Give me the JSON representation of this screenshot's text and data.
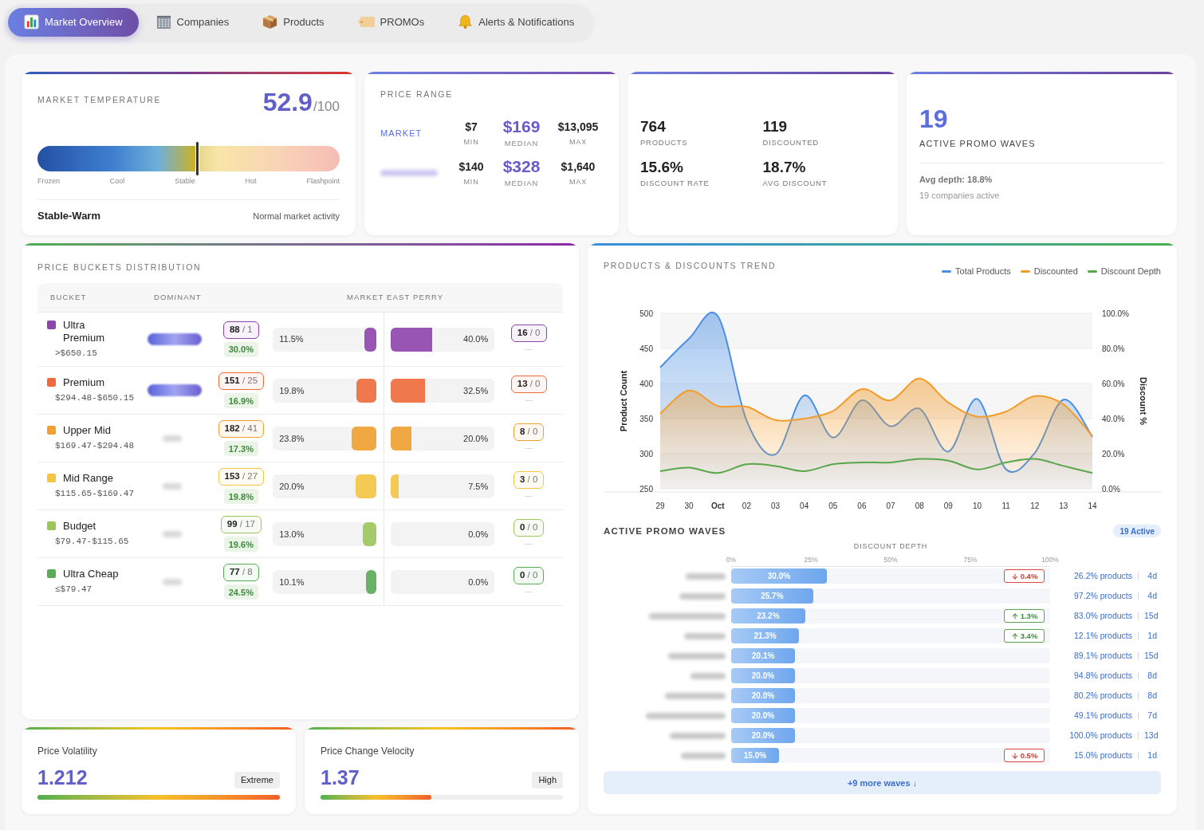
{
  "nav": {
    "tabs": [
      {
        "label": "Market Overview",
        "selected": true
      },
      {
        "label": "Companies",
        "selected": false
      },
      {
        "label": "Products",
        "selected": false
      },
      {
        "label": "PROMOs",
        "selected": false
      },
      {
        "label": "Alerts & Notifications",
        "selected": false
      }
    ]
  },
  "market_temperature": {
    "title": "MARKET TEMPERATURE",
    "value": "52.9",
    "scale": "/100",
    "level": 0.527,
    "scale_labels": [
      "Frozen",
      "Cool",
      "Stable",
      "Hot",
      "Flashpoint"
    ],
    "status": "Stable-Warm",
    "note": "Normal market activity"
  },
  "price_range": {
    "title": "PRICE RANGE",
    "rows": [
      {
        "label": "MARKET",
        "label_hidden": false,
        "min": "$7",
        "min_label": "MIN",
        "median": "$169",
        "median_label": "MEDIAN",
        "max": "$13,095",
        "max_label": "MAX"
      },
      {
        "label_hidden": true,
        "min": "$140",
        "min_label": "MIN",
        "median": "$328",
        "median_label": "MEDIAN",
        "max": "$1,640",
        "max_label": "MAX"
      }
    ]
  },
  "catalog_stats": {
    "items": [
      {
        "value": "764",
        "label": "PRODUCTS"
      },
      {
        "value": "119",
        "label": "DISCOUNTED"
      },
      {
        "value": "15.6%",
        "label": "DISCOUNT RATE"
      },
      {
        "value": "18.7%",
        "label": "AVG DISCOUNT"
      }
    ]
  },
  "promo_summary": {
    "value": "19",
    "label": "ACTIVE PROMO WAVES",
    "avg_depth": "Avg depth: 18.8%",
    "companies": "19 companies active"
  },
  "price_buckets": {
    "title": "PRICE BUCKETS DISTRIBUTION",
    "columns": [
      "BUCKET",
      "DOMINANT",
      "MARKET EAST PERRY"
    ],
    "rows": [
      {
        "name": "Ultra Premium",
        "range": ">$650.15",
        "color": "#8e44ad",
        "dominant": {
          "kind": "pill"
        },
        "market_count": "**88** / 1",
        "market_share": "30.0%",
        "market_bar": {
          "level": 0.115,
          "reading": "11.5%"
        },
        "east_perry_bar": {
          "level": 0.4,
          "reading": "40.0%"
        },
        "east_perry_count": "**16** / 0",
        "east_perry_note": "—"
      },
      {
        "name": "Premium",
        "range": "$294.48-$650.15",
        "color": "#ee6a3a",
        "dominant": {
          "kind": "pill"
        },
        "market_count": "**151** / 25",
        "market_share": "16.9%",
        "market_bar": {
          "level": 0.198,
          "reading": "19.8%"
        },
        "east_perry_bar": {
          "level": 0.325,
          "reading": "32.5%"
        },
        "east_perry_count": "**13** / 0",
        "east_perry_note": "—"
      },
      {
        "name": "Upper Mid",
        "range": "$169.47-$294.48",
        "color": "#f0a030",
        "dominant": {
          "kind": "plain"
        },
        "market_count": "**182** / 41",
        "market_share": "17.3%",
        "market_bar": {
          "level": 0.238,
          "reading": "23.8%"
        },
        "east_perry_bar": {
          "level": 0.2,
          "reading": "20.0%"
        },
        "east_perry_count": "**8** / 0",
        "east_perry_note": "—"
      },
      {
        "name": "Mid Range",
        "range": "$115.65-$169.47",
        "color": "#f5c542",
        "dominant": {
          "kind": "plain"
        },
        "market_count": "**153** / 27",
        "market_share": "19.8%",
        "market_bar": {
          "level": 0.2,
          "reading": "20.0%"
        },
        "east_perry_bar": {
          "level": 0.075,
          "reading": "7.5%"
        },
        "east_perry_count": "**3** / 0",
        "east_perry_note": "—"
      },
      {
        "name": "Budget",
        "range": "$79.47-$115.65",
        "color": "#9bc75a",
        "dominant": {
          "kind": "plain"
        },
        "market_count": "**99** / 17",
        "market_share": "19.6%",
        "market_bar": {
          "level": 0.13,
          "reading": "13.0%"
        },
        "east_perry_bar": {
          "level": 0,
          "reading": "0.0%"
        },
        "east_perry_count": "**0** / 0",
        "east_perry_note": "—"
      },
      {
        "name": "Ultra Cheap",
        "range": "≤$79.47",
        "color": "#5aab55",
        "dominant": {
          "kind": "plain"
        },
        "market_count": "**77** / 8",
        "market_share": "24.5%",
        "market_bar": {
          "level": 0.101,
          "reading": "10.1%"
        },
        "east_perry_bar": {
          "level": 0,
          "reading": "0.0%"
        },
        "east_perry_count": "**0** / 0",
        "east_perry_note": "—"
      }
    ]
  },
  "trend": {
    "title": "PRODUCTS & DISCOUNTS TREND",
    "chart_data": {
      "type": "area",
      "ylabel": "Product Count",
      "y2label": "Discount %",
      "grid": true,
      "categories": [
        "29",
        "30",
        "Oct",
        "02",
        "03",
        "04",
        "05",
        "06",
        "07",
        "08",
        "09",
        "10",
        "11",
        "12",
        "13",
        "14"
      ],
      "series": [
        {
          "name": "Total Products",
          "color": "#4a90e2",
          "values": [
            423,
            464,
            496,
            347,
            299,
            383,
            323,
            376,
            339,
            364,
            303,
            378,
            278,
            301,
            377,
            324
          ]
        },
        {
          "name": "Discounted",
          "color": "#f39c2b",
          "values": [
            357,
            390,
            368,
            367,
            348,
            350,
            361,
            392,
            376,
            407,
            373,
            353,
            360,
            382,
            370,
            325
          ]
        },
        {
          "name": "Discount Depth",
          "color": "#5aa64b",
          "type": "line",
          "axis": "y2",
          "values": [
            10,
            12,
            9,
            14,
            13,
            10,
            14,
            15,
            15,
            17,
            16,
            11,
            15,
            17,
            13,
            9
          ]
        }
      ],
      "ylim": [
        250,
        500
      ],
      "yticks": [
        250,
        300,
        350,
        400,
        450,
        500
      ],
      "y2lim": [
        0,
        100
      ],
      "y2ticks": [
        {
          "value": 0,
          "label": "0.0%"
        },
        {
          "value": 20,
          "label": "20.0%"
        },
        {
          "value": 40,
          "label": "40.0%"
        },
        {
          "value": 60,
          "label": "60.0%"
        },
        {
          "value": 80,
          "label": "80.0%"
        },
        {
          "value": 100,
          "label": "100.0%"
        }
      ]
    }
  },
  "promo_waves": {
    "title": "ACTIVE PROMO WAVES",
    "badge": "19 Active",
    "axis_title": "DISCOUNT DEPTH",
    "axis_ticks": [
      "0%",
      "25%",
      "50%",
      "75%",
      "100%"
    ],
    "waves": [
      {
        "level": 0.3,
        "reading": "30.0%",
        "change": {
          "rising": false,
          "text": "0.4%"
        },
        "coverage": "26.2% products",
        "duration": "4d"
      },
      {
        "level": 0.257,
        "reading": "25.7%",
        "coverage": "97.2% products",
        "duration": "4d"
      },
      {
        "level": 0.232,
        "reading": "23.2%",
        "change": {
          "rising": true,
          "text": "1.3%"
        },
        "coverage": "83.0% products",
        "duration": "15d"
      },
      {
        "level": 0.213,
        "reading": "21.3%",
        "change": {
          "rising": true,
          "text": "3.4%"
        },
        "coverage": "12.1% products",
        "duration": "1d"
      },
      {
        "level": 0.201,
        "reading": "20.1%",
        "coverage": "89.1% products",
        "duration": "15d"
      },
      {
        "level": 0.2,
        "reading": "20.0%",
        "coverage": "94.8% products",
        "duration": "8d"
      },
      {
        "level": 0.2,
        "reading": "20.0%",
        "coverage": "80.2% products",
        "duration": "8d"
      },
      {
        "level": 0.2,
        "reading": "20.0%",
        "coverage": "49.1% products",
        "duration": "7d"
      },
      {
        "level": 0.2,
        "reading": "20.0%",
        "coverage": "100.0% products",
        "duration": "13d"
      },
      {
        "level": 0.15,
        "reading": "15.0%",
        "change": {
          "rising": false,
          "text": "0.5%"
        },
        "coverage": "15.0% products",
        "duration": "1d"
      }
    ],
    "more_button": "+9 more waves ↓"
  },
  "indicators": [
    {
      "title": "Price Volatility",
      "value": "1.212",
      "badge": "Extreme",
      "level": 1.0
    },
    {
      "title": "Price Change Velocity",
      "value": "1.37",
      "badge": "High",
      "level": 0.456
    }
  ]
}
